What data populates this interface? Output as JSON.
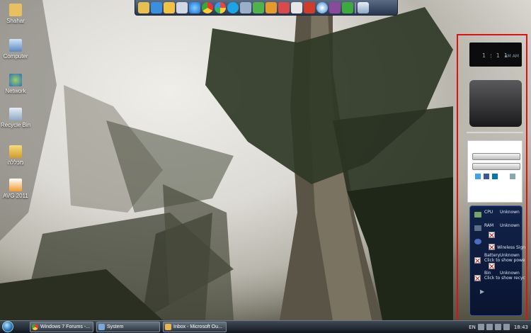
{
  "desktop_icons": [
    {
      "label": "Shahar",
      "icon": "user-folder-icon"
    },
    {
      "label": "Computer",
      "icon": "computer-icon"
    },
    {
      "label": "Network",
      "icon": "network-icon"
    },
    {
      "label": "Recycle Bin",
      "icon": "recycle-bin-icon"
    },
    {
      "label": "מכללה",
      "icon": "folder-icon"
    },
    {
      "label": "AVG 2011",
      "icon": "avg-icon"
    }
  ],
  "quick_launch": {
    "icons": [
      "folder-icon",
      "dropbox-icon",
      "outlook-icon",
      "notepad-icon",
      "internet-explorer-icon",
      "chrome-icon",
      "picasa-icon",
      "skype-icon",
      "network-icon",
      "messenger-icon",
      "seven-icon",
      "paint-icon",
      "pen-icon",
      "flash-icon",
      "itunes-icon",
      "winrar-icon",
      "utorrent-icon",
      "recycle-icon"
    ]
  },
  "sidebar": {
    "clock": {
      "time": "1:11",
      "ampm": "AM AM"
    },
    "meter": {
      "cpu_label": "CPU",
      "cpu_value": "Unknown",
      "ram_label": "RAM",
      "ram_value": "Unknown",
      "wireless_label": "Wireless Sign",
      "battery_label": "Battery",
      "battery_value": "Unknown",
      "battery_hint": "Click to show powe",
      "bin_label": "Bin",
      "bin_value": "Unknown",
      "bin_hint": "Click to show recyc"
    }
  },
  "taskbar": {
    "items": [
      {
        "label": "Windows 7 Forums -...",
        "icon": "chrome-icon",
        "color": "#4a90e2"
      },
      {
        "label": "System",
        "icon": "system-icon",
        "color": "#7aa6d8"
      },
      {
        "label": "Inbox - Microsoft Ou...",
        "icon": "outlook-icon",
        "color": "#e8b64a"
      }
    ],
    "language": "EN",
    "time": "18:43"
  },
  "colors": {
    "highlight_frame": "#e01010"
  }
}
